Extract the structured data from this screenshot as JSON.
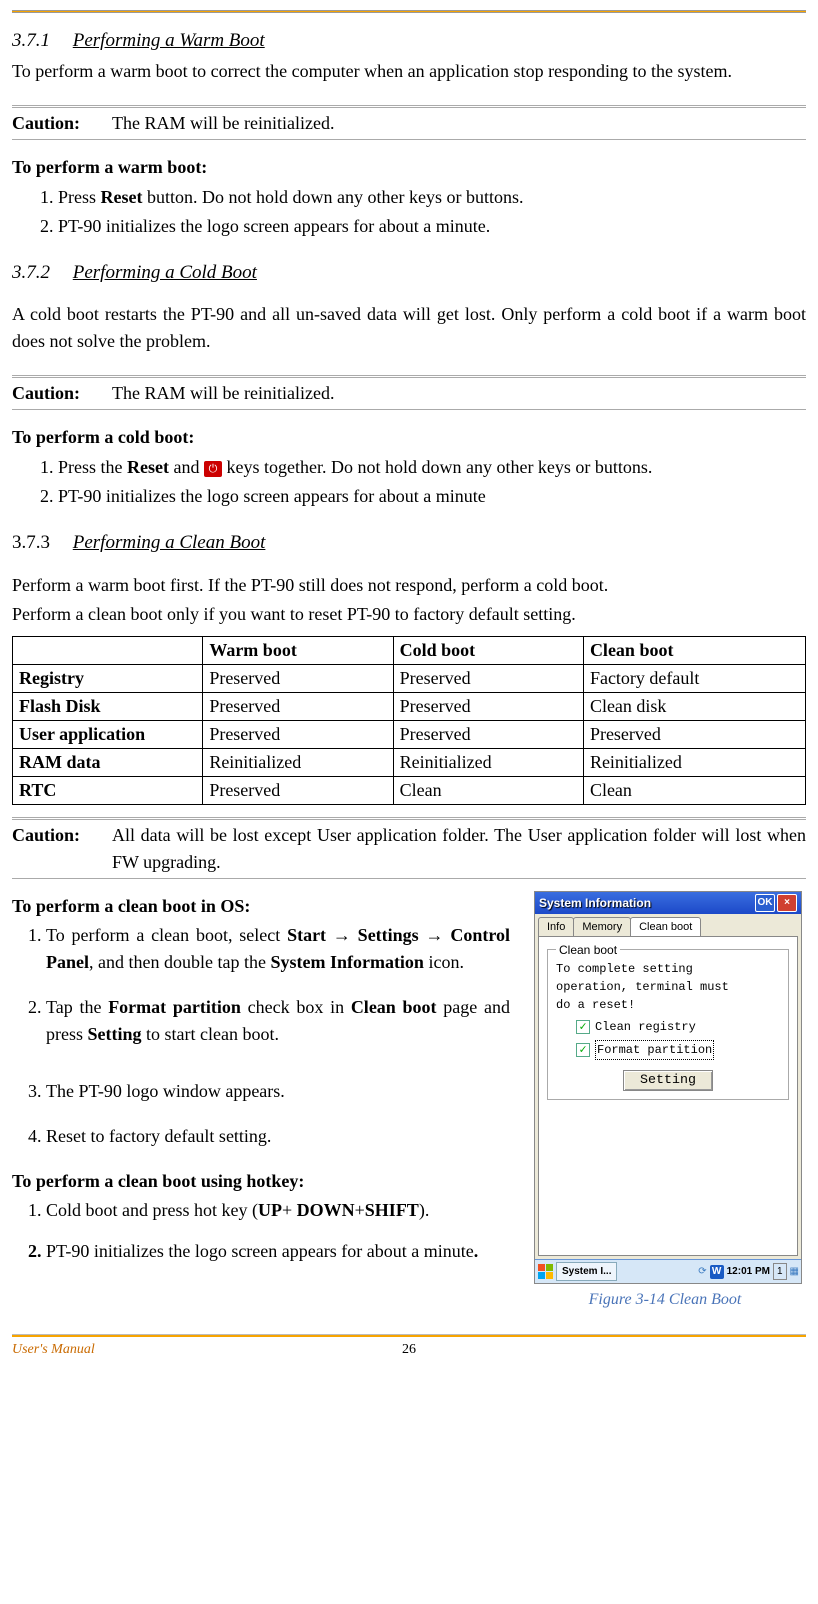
{
  "sec1": {
    "num": "3.7.1",
    "title": "Performing a Warm Boot",
    "intro": "To perform a warm boot to correct the computer when an application stop responding to the system.",
    "caution_label": "Caution:",
    "caution_text": "The RAM will be reinitialized.",
    "procedure_head": "To perform a warm boot:",
    "step1_a": "Press ",
    "step1_b": "Reset",
    "step1_c": " button. Do not hold down any other keys or buttons.",
    "step2": "PT-90 initializes the logo screen appears for about a minute."
  },
  "sec2": {
    "num": "3.7.2",
    "title": "Performing a Cold Boot",
    "intro": "A cold boot restarts the PT-90 and all un-saved data will get lost. Only perform a cold boot if a warm boot does not solve the problem.",
    "caution_label": "Caution:",
    "caution_text": "The RAM will be reinitialized.",
    "procedure_head": "To perform a cold boot:",
    "step1_a": "Press the ",
    "step1_b": "Reset",
    "step1_c": " and ",
    "step1_d": " keys together. Do not hold down any other keys or buttons.",
    "step2": "PT-90 initializes the logo screen appears for about a minute"
  },
  "sec3": {
    "num": "3.7.3",
    "title": "Performing a Clean Boot",
    "intro1": "Perform a warm boot first. If the PT-90 still does not respond, perform a cold boot.",
    "intro2": "Perform a clean boot only if you want to reset PT-90 to factory default setting."
  },
  "table": {
    "h0": "",
    "h1": "Warm boot",
    "h2": "Cold boot",
    "h3": "Clean boot",
    "rows": [
      {
        "n": "Registry",
        "w": "Preserved",
        "c": "Preserved",
        "l": "Factory default"
      },
      {
        "n": "Flash Disk",
        "w": "Preserved",
        "c": "Preserved",
        "l": "Clean disk"
      },
      {
        "n": "User application",
        "w": "Preserved",
        "c": "Preserved",
        "l": "Preserved"
      },
      {
        "n": "RAM data",
        "w": "Reinitialized",
        "c": "Reinitialized",
        "l": "Reinitialized"
      },
      {
        "n": "RTC",
        "w": "Preserved",
        "c": "Clean",
        "l": "Clean"
      }
    ]
  },
  "caution3": {
    "label": "Caution:",
    "text": "All data will be lost except User application folder. The User application folder will lost when FW upgrading."
  },
  "cleanOS": {
    "head": "To perform a clean boot in OS:",
    "s1_a": "To perform a clean boot, select ",
    "s1_b": "Start → Settings → Control Panel",
    "s1_c": ", and then double tap the ",
    "s1_d": "System Information",
    "s1_e": " icon.",
    "s2_a": "Tap the ",
    "s2_b": "Format partition",
    "s2_c": " check box in ",
    "s2_d": "Clean boot",
    "s2_e": " page and press ",
    "s2_f": "Setting",
    "s2_g": " to start clean boot.",
    "s3": "The PT-90 logo window appears.",
    "s4": "Reset to factory default setting."
  },
  "cleanHK": {
    "head": "To perform a clean boot using hotkey:",
    "s1_a": "Cold boot and press hot key (",
    "s1_b": "UP",
    "s1_c": "+ ",
    "s1_d": "DOWN",
    "s1_e": "+",
    "s1_f": "SHIFT",
    "s1_g": ").",
    "s2_a": "PT-90 initializes the logo screen appears for about a minute",
    "s2_b": "."
  },
  "window": {
    "title": "System Information",
    "ok": "OK",
    "x": "×",
    "tabs": {
      "info": "Info",
      "memory": "Memory",
      "cleanboot": "Clean boot"
    },
    "group": "Clean boot",
    "msg1": "To complete setting",
    "msg2": "operation, terminal must",
    "msg3": "do a reset!",
    "chk1": "Clean registry",
    "chk2": "Format partition",
    "setting": "Setting",
    "task_app": "System I...",
    "time": "12:01 PM",
    "tray_num": "1"
  },
  "figcap": "Figure 3-14 Clean Boot",
  "footer": {
    "um": "User's Manual",
    "page": "26"
  },
  "power_glyph": "⏻"
}
